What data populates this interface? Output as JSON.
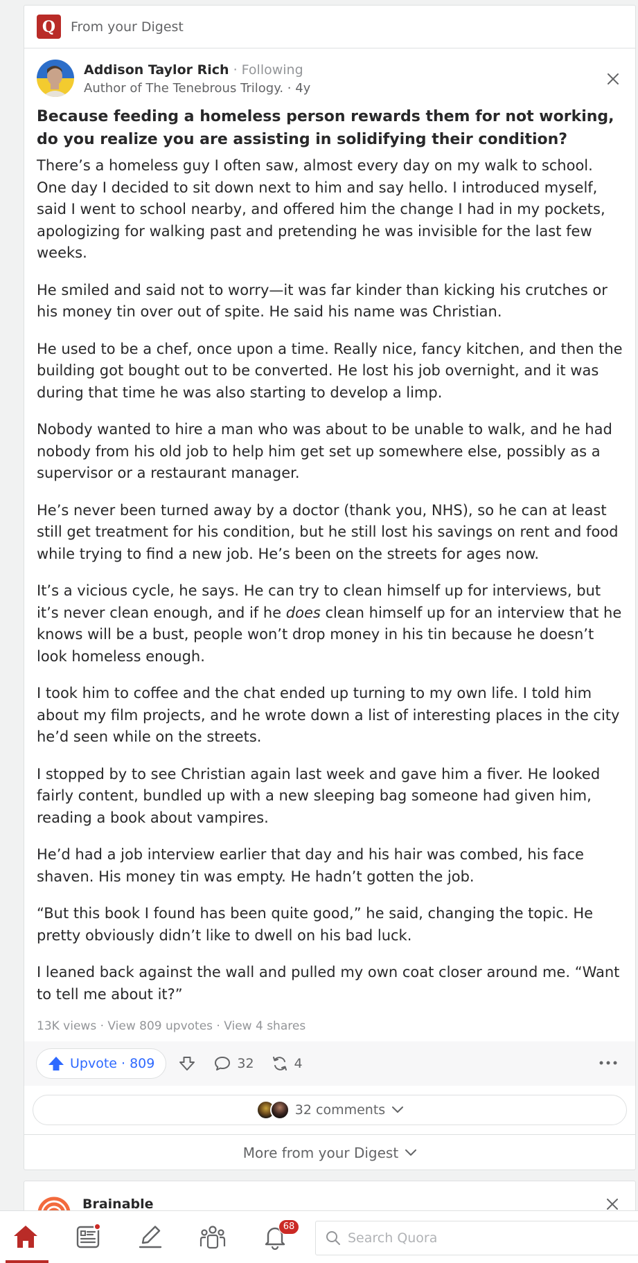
{
  "digest": {
    "label": "From your Digest",
    "logo_letter": "Q"
  },
  "post": {
    "author": {
      "name": "Addison Taylor Rich",
      "follow_status": "· Following",
      "credential": "Author of The Tenebrous Trilogy. · 4y"
    },
    "question": "Because feeding a homeless person rewards them for not working, do you realize you are assisting in solidifying their condition?",
    "paragraphs": {
      "p1": "There’s a homeless guy I often saw, almost every day on my walk to school. One day I decided to sit down next to him and say hello. I introduced myself, said I went to school nearby, and offered him the change I had in my pockets, apologizing for walking past and pretending he was invisible for the last few weeks.",
      "p2": "He smiled and said not to worry—it was far kinder than kicking his crutches or his money tin over out of spite. He said his name was Christian.",
      "p3": "He used to be a chef, once upon a time. Really nice, fancy kitchen, and then the building got bought out to be converted. He lost his job overnight, and it was during that time he was also starting to develop a limp.",
      "p4": "Nobody wanted to hire a man who was about to be unable to walk, and he had nobody from his old job to help him get set up somewhere else, possibly as a supervisor or a restaurant manager.",
      "p5": "He’s never been turned away by a doctor (thank you, NHS), so he can at least still get treatment for his condition, but he still lost his savings on rent and food while trying to find a new job. He’s been on the streets for ages now.",
      "p6a": "It’s a vicious cycle, he says. He can try to clean himself up for interviews, but it’s never clean enough, and if he ",
      "p6em": "does",
      "p6b": " clean himself up for an interview that he knows will be a bust, people won’t drop money in his tin because he doesn’t look homeless enough.",
      "p7": "I took him to coffee and the chat ended up turning to my own life. I told him about my film projects, and he wrote down a list of interesting places in the city he’d seen while on the streets.",
      "p8": "I stopped by to see Christian again last week and gave him a fiver. He looked fairly content, bundled up with a new sleeping bag someone had given him, reading a book about vampires.",
      "p9": "He’d had a job interview earlier that day and his hair was combed, his face shaven. His money tin was empty. He hadn’t gotten the job.",
      "p10": "“But this book I found has been quite good,” he said, changing the topic. He pretty obviously didn’t like to dwell on his bad luck.",
      "p11": "I leaned back against the wall and pulled my own coat closer around me. “Want to tell me about it?”"
    },
    "stats": {
      "views": "13K views",
      "upvotes_link": "View 809 upvotes",
      "shares_link": "View 4 shares",
      "sep": " · "
    },
    "actions": {
      "upvote_label": "Upvote · 809",
      "comment_count": "32",
      "share_count": "4"
    },
    "comments_toggle": "32 comments",
    "more_from_digest": "More from your Digest"
  },
  "next_card": {
    "name": "Brainable"
  },
  "bottom_nav": {
    "notification_count": "68",
    "search_placeholder": "Search Quora"
  },
  "colors": {
    "brand": "#b92b27",
    "upvote_blue": "#2e69ff",
    "text": "#282829",
    "muted": "#636466",
    "light": "#939598"
  }
}
